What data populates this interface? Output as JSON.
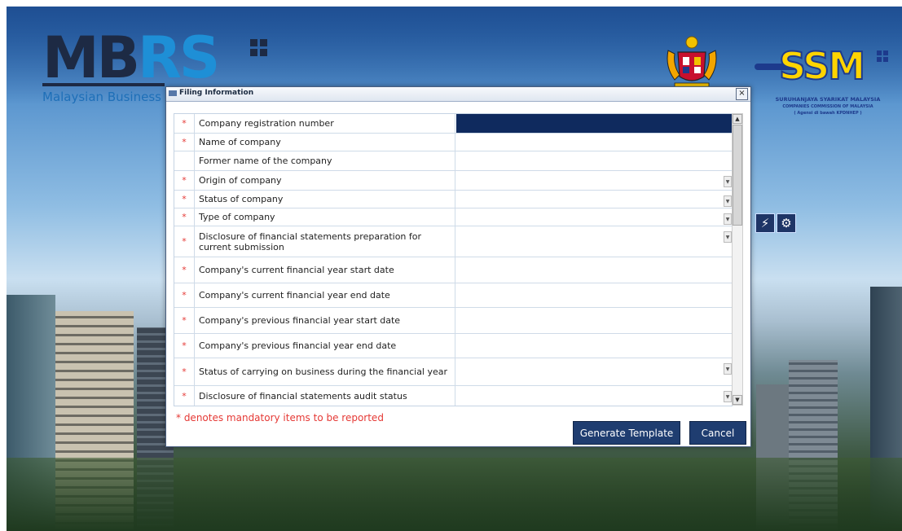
{
  "background": {
    "mbrs": {
      "logo_text": "MBRS",
      "subtitle": "Malaysian Business F"
    },
    "ssm": {
      "logo_text": "SSM",
      "line1": "SURUHANJAYA SYARIKAT MALAYSIA",
      "line2": "COMPANIES COMMISSION OF MALAYSIA",
      "line3": "( Agensi di bawah KPDNHEP )"
    }
  },
  "dialog": {
    "title": "Filing Information",
    "close_glyph": "×",
    "rows": [
      {
        "label": "Company registration number",
        "required": "*",
        "dropdown": false,
        "selected": true
      },
      {
        "label": "Name of company",
        "required": "*",
        "dropdown": false,
        "selected": false
      },
      {
        "label": "Former name of the company",
        "required": "",
        "dropdown": false,
        "selected": false
      },
      {
        "label": "Origin of company",
        "required": "*",
        "dropdown": true,
        "selected": false
      },
      {
        "label": "Status of company",
        "required": "*",
        "dropdown": true,
        "selected": false
      },
      {
        "label": "Type of company",
        "required": "*",
        "dropdown": true,
        "selected": false
      },
      {
        "label": "Disclosure of financial statements preparation for current submission",
        "required": "*",
        "dropdown": true,
        "selected": false
      },
      {
        "label": "Company's current financial year start date",
        "required": "*",
        "dropdown": false,
        "selected": false
      },
      {
        "label": "Company's current financial year end date",
        "required": "*",
        "dropdown": false,
        "selected": false
      },
      {
        "label": "Company's previous financial year start date",
        "required": "*",
        "dropdown": false,
        "selected": false
      },
      {
        "label": "Company's previous financial year end date",
        "required": "*",
        "dropdown": false,
        "selected": false
      },
      {
        "label": "Status of carrying on business during the financial year",
        "required": "*",
        "dropdown": true,
        "selected": false
      },
      {
        "label": "Disclosure of financial statements audit status",
        "required": "*",
        "dropdown": true,
        "selected": false
      }
    ],
    "mandatory_note": "* denotes mandatory items to be reported",
    "generate_label": "Generate Template",
    "cancel_label": "Cancel"
  },
  "colors": {
    "accent": "#1f3d70",
    "required": "#e53935",
    "selected_cell": "#0f2a5e"
  }
}
